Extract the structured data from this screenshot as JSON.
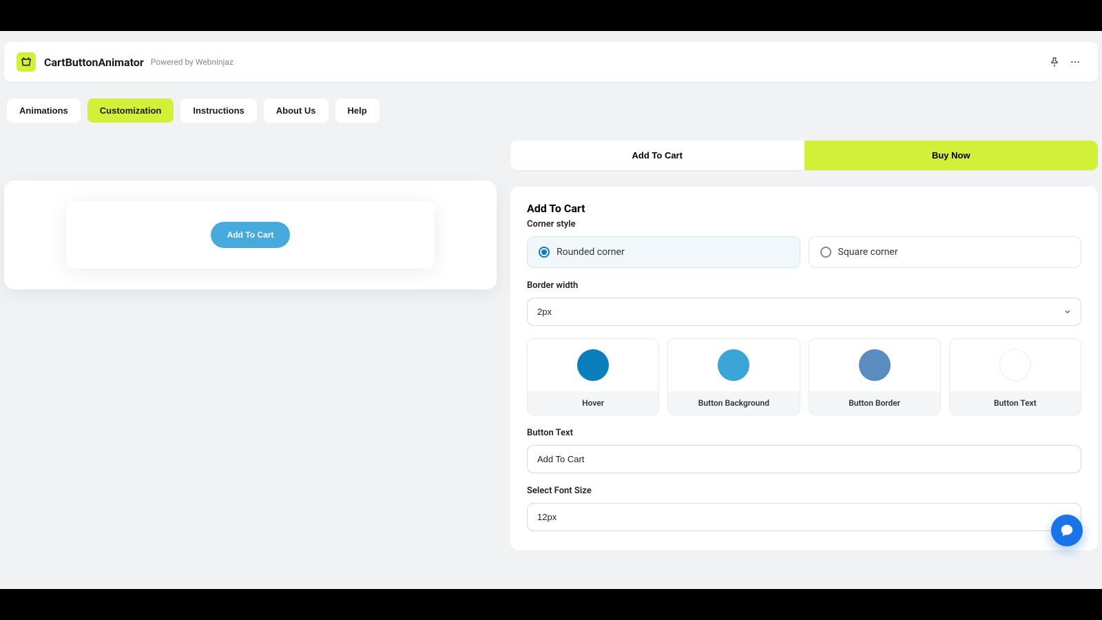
{
  "header": {
    "app_name": "CartButtonAnimator",
    "powered_by": "Powered by Webninjaz"
  },
  "tabs": {
    "animations": "Animations",
    "customization": "Customization",
    "instructions": "Instructions",
    "about_us": "About Us",
    "help": "Help"
  },
  "preview": {
    "button_label": "Add To Cart"
  },
  "sub_tabs": {
    "add_to_cart": "Add To Cart",
    "buy_now": "Buy Now"
  },
  "panel": {
    "title": "Add To Cart",
    "corner_style_label": "Corner style",
    "corner_rounded": "Rounded corner",
    "corner_square": "Square corner",
    "border_width_label": "Border width",
    "border_width_value": "2px",
    "colors": {
      "hover": {
        "label": "Hover",
        "hex": "#0b7fbc"
      },
      "button_background": {
        "label": "Button Background",
        "hex": "#3aa6d8"
      },
      "button_border": {
        "label": "Button Border",
        "hex": "#5a8cc0"
      },
      "button_text": {
        "label": "Button Text",
        "hex": "#ffffff",
        "ring": "#eceef0"
      }
    },
    "button_text_label": "Button Text",
    "button_text_value": "Add To Cart",
    "font_size_label": "Select Font Size",
    "font_size_value": "12px"
  }
}
